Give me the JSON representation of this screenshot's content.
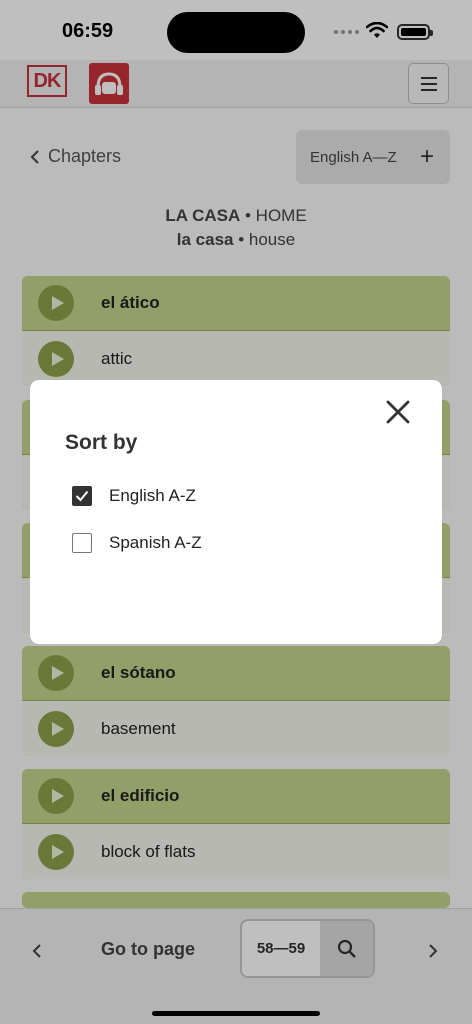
{
  "status": {
    "time": "06:59"
  },
  "header": {
    "dk_logo": "DK",
    "app_logo_text": "A-Z",
    "menu_icon": "hamburger-icon"
  },
  "nav": {
    "back_label": "Chapters",
    "sort_label": "English A—Z"
  },
  "heading": {
    "line1_bold": "LA CASA",
    "line1_rest": " • HOME",
    "line2_bold": "la casa",
    "line2_rest": " • house"
  },
  "cards": [
    {
      "spanish": "el ático",
      "english": "attic"
    },
    {
      "spanish": "el sótano",
      "english": "basement"
    },
    {
      "spanish": "el edificio",
      "english": "block of flats"
    }
  ],
  "bottom": {
    "goto_label": "Go to page",
    "page_value": "58—59"
  },
  "modal": {
    "title": "Sort by",
    "options": [
      {
        "label": "English A-Z",
        "checked": true
      },
      {
        "label": "Spanish A-Z",
        "checked": false
      }
    ]
  },
  "colors": {
    "brand_red": "#c9323b",
    "card_green": "#c4d58d",
    "play_green": "#8ea24a"
  }
}
